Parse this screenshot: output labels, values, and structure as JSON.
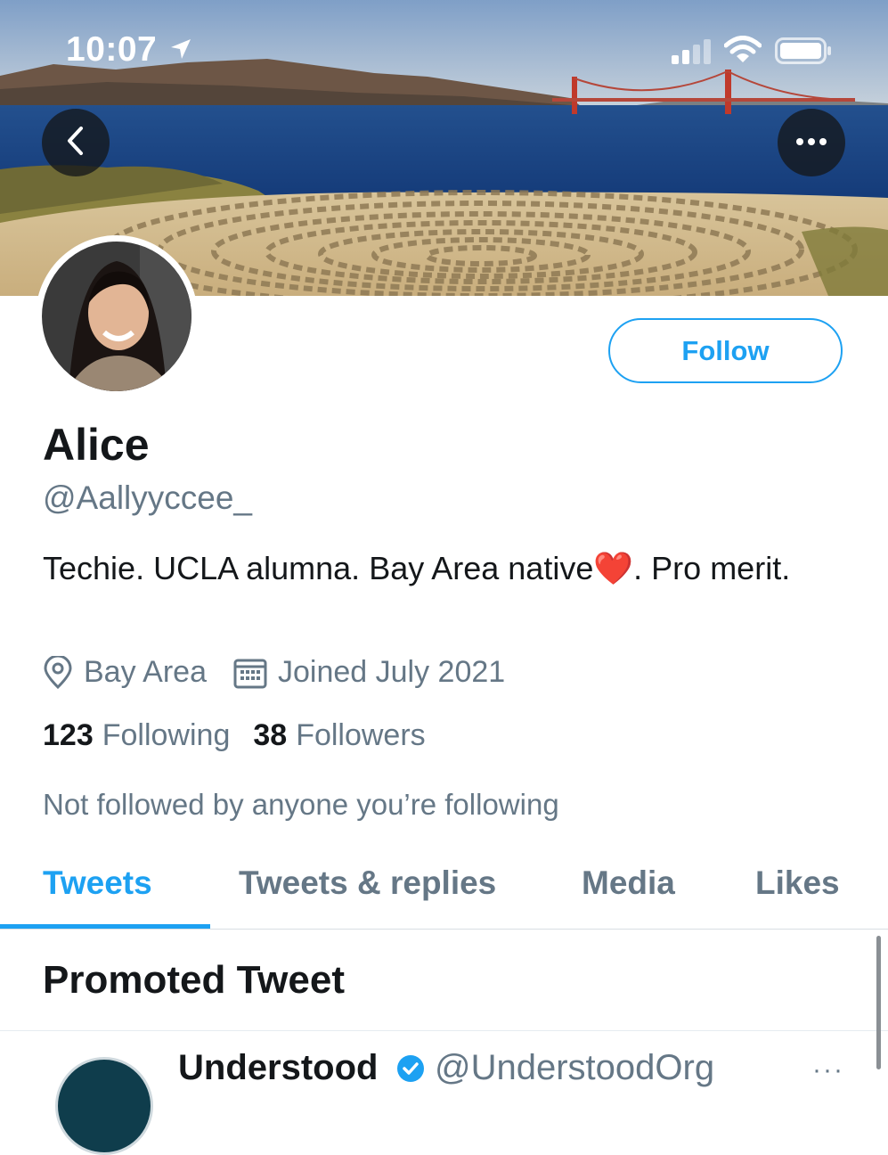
{
  "status_bar": {
    "time": "10:07"
  },
  "header": {
    "back_icon": "chevron-left-icon",
    "more_icon": "ellipsis-icon"
  },
  "profile": {
    "name": "Alice",
    "handle": "@Aallyyccee_",
    "bio": "Techie. UCLA alumna. Bay Area native❤️. Pro merit.",
    "location": "Bay Area",
    "joined": "Joined July 2021",
    "following_count": "123",
    "following_label": "Following",
    "followers_count": "38",
    "followers_label": "Followers",
    "not_followed": "Not followed by anyone you’re following",
    "follow_label": "Follow"
  },
  "tabs": [
    {
      "label": "Tweets",
      "active": true
    },
    {
      "label": "Tweets & replies",
      "active": false
    },
    {
      "label": "Media",
      "active": false
    },
    {
      "label": "Likes",
      "active": false
    }
  ],
  "promoted": {
    "heading": "Promoted Tweet",
    "author": "Understood",
    "handle": "@UnderstoodOrg",
    "more": "···"
  },
  "colors": {
    "accent": "#1da1f2",
    "secondary_text": "#657786",
    "primary_text": "#14171a"
  }
}
